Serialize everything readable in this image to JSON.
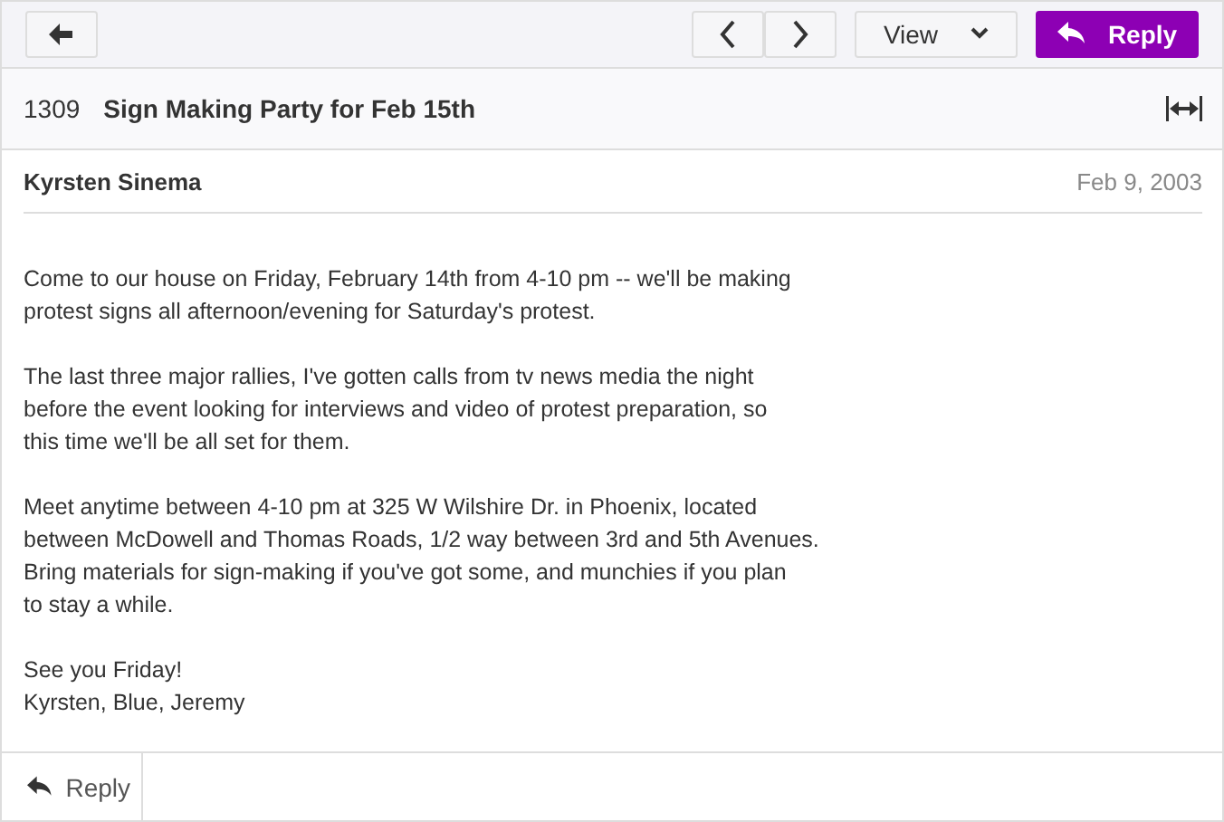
{
  "toolbar": {
    "view_label": "View",
    "reply_label": "Reply"
  },
  "message": {
    "number": "1309",
    "subject": "Sign Making Party for Feb 15th",
    "sender": "Kyrsten Sinema",
    "date": "Feb 9, 2003",
    "paragraphs": [
      "Come to our house on Friday, February 14th from 4-10 pm -- we'll be making\nprotest signs all afternoon/evening for Saturday's protest.",
      "The last three major rallies, I've gotten calls from tv news media the night\nbefore the event looking for interviews and video of protest preparation, so\nthis time we'll be all set for them.",
      "Meet anytime between 4-10 pm at 325 W Wilshire Dr. in Phoenix, located\nbetween McDowell and Thomas Roads, 1/2 way between 3rd and 5th Avenues.\nBring materials for sign-making if you've got some, and munchies if you plan\nto stay a while.",
      "See you Friday!\nKyrsten, Blue, Jeremy"
    ]
  },
  "footer": {
    "reply_label": "Reply"
  }
}
